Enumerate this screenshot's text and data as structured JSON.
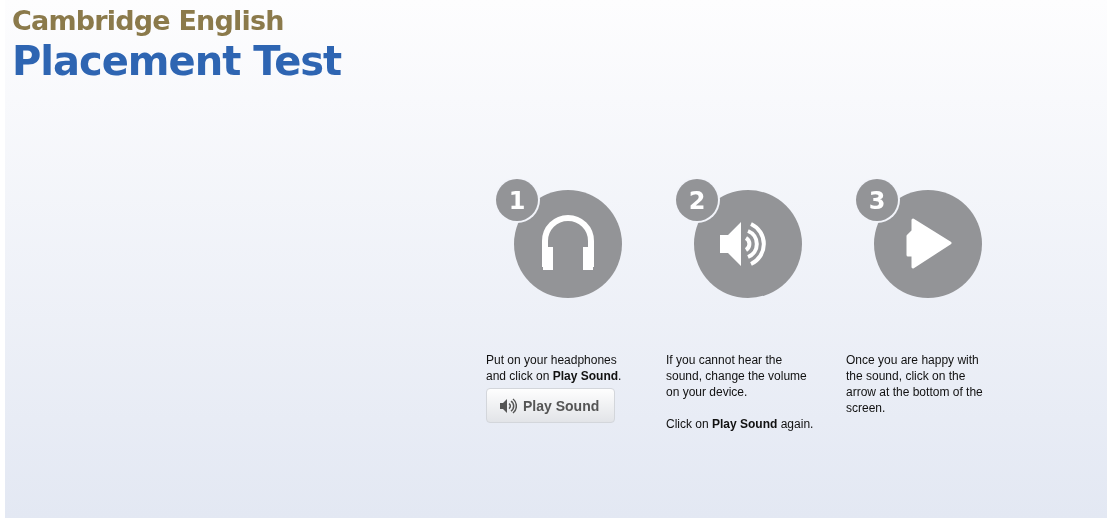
{
  "logo": {
    "line_1": "Cambridge English",
    "line_2": "Placement Test"
  },
  "steps": [
    {
      "number": "1",
      "kind": "headphones",
      "paragraphs": [
        "Put on your headphones and click on **Play Sound**."
      ],
      "button": "Play Sound"
    },
    {
      "number": "2",
      "kind": "speaker",
      "paragraphs": [
        "If you cannot hear the sound, change the volume on your device.",
        "Click on **Play Sound** again."
      ]
    },
    {
      "number": "3",
      "kind": "play",
      "paragraphs": [
        "Once you are happy with the sound, click on the arrow at the bottom of the screen."
      ]
    }
  ]
}
